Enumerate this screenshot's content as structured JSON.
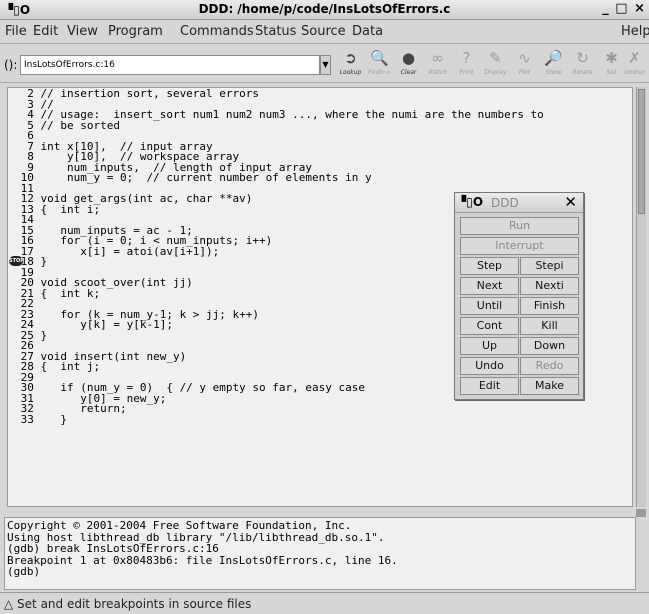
{
  "window": {
    "title": "DDD: /home/p/code/InsLotsOfErrors.c",
    "icon_text": "▝▯O",
    "controls": "_ □ ×"
  },
  "menu": [
    "File",
    "Edit",
    "View",
    "Program",
    "Commands",
    "Status",
    "Source",
    "Data",
    "Help"
  ],
  "toolbar": {
    "arg_label": "():",
    "arg_value": "InsLotsOfErrors.c:16",
    "buttons": [
      {
        "label": "Lookup",
        "icon": "lookup-icon",
        "glyph": "➲",
        "enabled": true
      },
      {
        "label": "Find>>",
        "icon": "find-icon",
        "glyph": "🔍",
        "enabled": false
      },
      {
        "label": "Clear",
        "icon": "clear-icon",
        "glyph": "●",
        "enabled": true
      },
      {
        "label": "Watch",
        "icon": "watch-icon",
        "glyph": "∞",
        "enabled": false
      },
      {
        "label": "Print",
        "icon": "print-icon",
        "glyph": "?",
        "enabled": false
      },
      {
        "label": "Display",
        "icon": "display-icon",
        "glyph": "✎",
        "enabled": false
      },
      {
        "label": "Plot",
        "icon": "plot-icon",
        "glyph": "∿",
        "enabled": false
      },
      {
        "label": "Show",
        "icon": "show-icon",
        "glyph": "🔎",
        "enabled": false
      },
      {
        "label": "Rotate",
        "icon": "rotate-icon",
        "glyph": "↻",
        "enabled": false
      },
      {
        "label": "Set",
        "icon": "set-icon",
        "glyph": "✱",
        "enabled": false
      },
      {
        "label": "Undisp",
        "icon": "undisplay-icon",
        "glyph": "✗",
        "enabled": false
      }
    ]
  },
  "source_code": "  2 // insertion sort, several errors\n  3 //\n  4 // usage:  insert_sort num1 num2 num3 ..., where the numi are the numbers to\n  5 // be sorted\n  6\n  7 int x[10],  // input array\n  8     y[10],  // workspace array\n  9     num_inputs,  // length of input array\n 10     num_y = 0;  // current number of elements in y\n 11\n 12 void get_args(int ac, char **av)\n 13 {  int i;\n 14\n 15    num_inputs = ac - 1;\n 16    for (i = 0; i < num_inputs; i++)\n 17       x[i] = atoi(av[i+1]);\n 18 }\n 19\n 20 void scoot_over(int jj)\n 21 {  int k;\n 22\n 23    for (k = num_y-1; k > jj; k++)\n 24       y[k] = y[k-1];\n 25 }\n 26\n 27 void insert(int new_y)\n 28 {  int j;\n 29\n 30    if (num_y = 0)  { // y empty so far, easy case\n 31       y[0] = new_y;\n 32       return;\n 33    }",
  "breakpoint": {
    "line": "16",
    "marker": "STOP"
  },
  "console_text": "Copyright © 2001-2004 Free Software Foundation, Inc.\nUsing host libthread_db library \"/lib/libthread_db.so.1\".\n(gdb) break InsLotsOfErrors.c:16\nBreakpoint 1 at 0x80483b6: file InsLotsOfErrors.c, line 16.\n(gdb)",
  "status": "Set and edit breakpoints in source files",
  "command_tool": {
    "title": "DDD",
    "buttons": {
      "run": "Run",
      "interrupt": "Interrupt",
      "step": "Step",
      "stepi": "Stepi",
      "next": "Next",
      "nexti": "Nexti",
      "until": "Until",
      "finish": "Finish",
      "cont": "Cont",
      "kill": "Kill",
      "up": "Up",
      "down": "Down",
      "undo": "Undo",
      "redo": "Redo",
      "edit": "Edit",
      "make": "Make"
    }
  }
}
